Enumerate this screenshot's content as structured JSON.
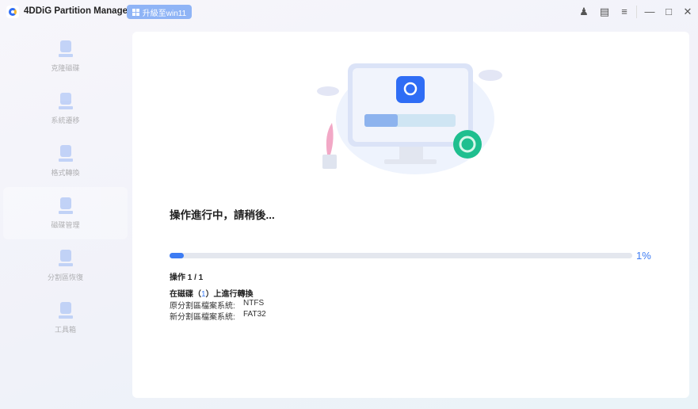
{
  "app": {
    "title": "4DDiG Partition Manager",
    "upgrade_label": "升級至win11"
  },
  "window_controls": {
    "account": "account-icon",
    "feedback": "feedback-icon",
    "menu": "menu-icon",
    "minimize": "minimize-icon",
    "maximize": "maximize-icon",
    "close": "close-icon"
  },
  "sidebar": {
    "items": [
      {
        "label": "克隆磁碟"
      },
      {
        "label": "系統遷移"
      },
      {
        "label": "格式轉換"
      },
      {
        "label": "磁碟管理"
      },
      {
        "label": "分割區恢復"
      },
      {
        "label": "工具箱"
      }
    ]
  },
  "progress": {
    "status": "操作進行中，請稍後...",
    "percent": 1,
    "percent_label": "1%",
    "operation": "操作 1 / 1"
  },
  "details": {
    "prefix": "在磁碟（",
    "disk": "1",
    "suffix": "）上進行轉換",
    "orig_label": "原分割區檔案系統:",
    "orig_value": "NTFS",
    "new_label": "新分割區檔案系統:",
    "new_value": "FAT32"
  },
  "colors": {
    "accent": "#3d7cf3",
    "upgrade_bg": "#8fb4f6",
    "ring": "#1fbf8f"
  }
}
